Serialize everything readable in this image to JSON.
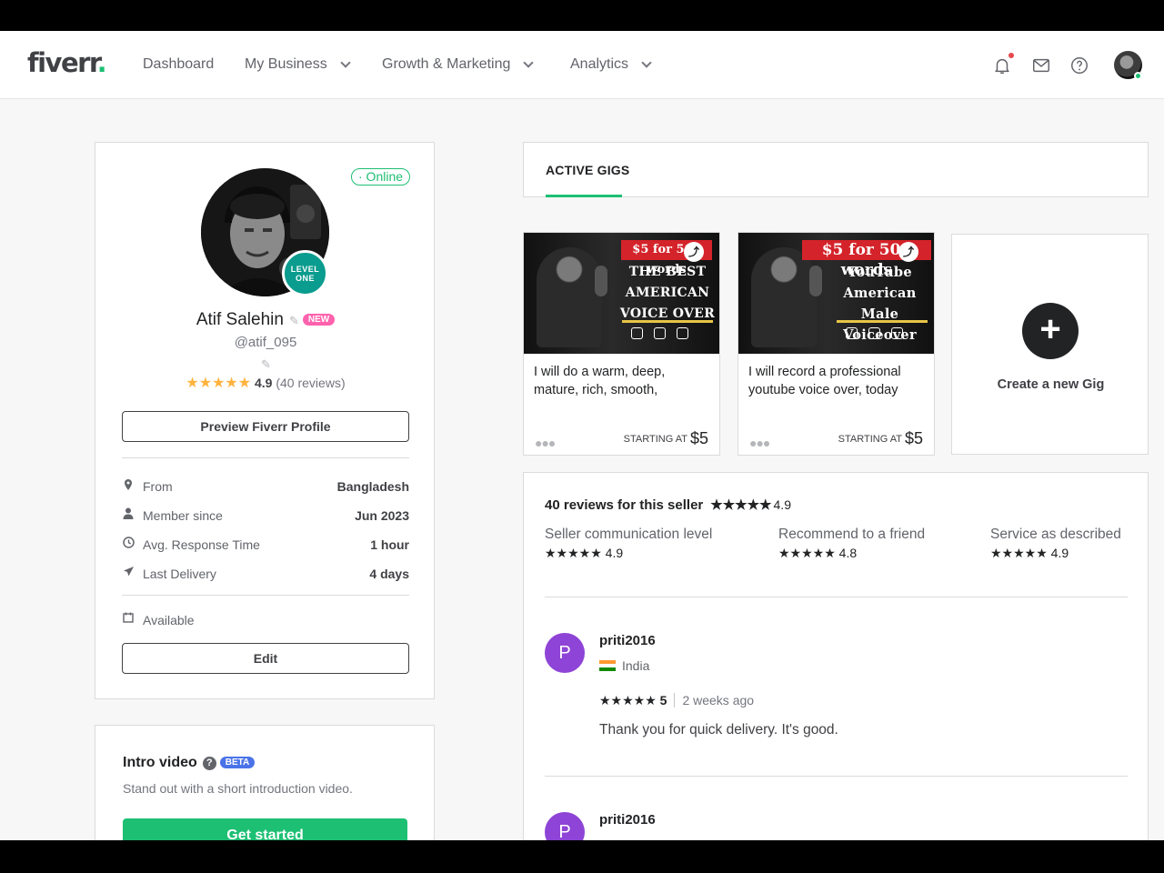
{
  "header": {
    "logo": "fiverr",
    "logo_dot": ".",
    "nav": [
      "Dashboard",
      "My Business",
      "Growth & Marketing",
      "Analytics"
    ]
  },
  "profile": {
    "status": "· Online",
    "level_line1": "LEVEL",
    "level_line2": "ONE",
    "name": "Atif Salehin",
    "new_badge": "NEW",
    "handle": "@atif_095",
    "rating": "4.9",
    "reviews": "(40 reviews)",
    "preview_button": "Preview Fiverr Profile",
    "info": [
      {
        "label": "From",
        "value": "Bangladesh"
      },
      {
        "label": "Member since",
        "value": "Jun 2023"
      },
      {
        "label": "Avg. Response Time",
        "value": "1 hour"
      },
      {
        "label": "Last Delivery",
        "value": "4 days"
      }
    ],
    "availability": "Available",
    "edit_button": "Edit"
  },
  "intro": {
    "title": "Intro video",
    "help": "?",
    "beta": "BETA",
    "subtitle": "Stand out with a short introduction video.",
    "button": "Get started"
  },
  "gigs": {
    "tab": "ACTIVE GIGS",
    "items": [
      {
        "banner": "$5 for 500 words",
        "headline": "THE BEST AMERICAN VOICE OVER",
        "title": "I will do a warm, deep, mature, rich, smooth,",
        "starting_label": "STARTING AT",
        "price": "$5"
      },
      {
        "banner": "$5 for 500 words",
        "headline": "YouTube American Male Voiceover",
        "title": "I will record a professional youtube voice over, today",
        "starting_label": "STARTING AT",
        "price": "$5"
      }
    ],
    "create_label": "Create a new Gig"
  },
  "reviews": {
    "heading": "40 reviews for this seller",
    "overall": "4.9",
    "categories": [
      {
        "label": "Seller communication level",
        "value": "4.9"
      },
      {
        "label": "Recommend to a friend",
        "value": "4.8"
      },
      {
        "label": "Service as described",
        "value": "4.9"
      }
    ],
    "items": [
      {
        "initial": "P",
        "user": "priti2016",
        "country": "India",
        "rating": "5",
        "when": "2 weeks ago",
        "text": "Thank you for quick delivery. It's good."
      },
      {
        "initial": "P",
        "user": "priti2016"
      }
    ]
  }
}
